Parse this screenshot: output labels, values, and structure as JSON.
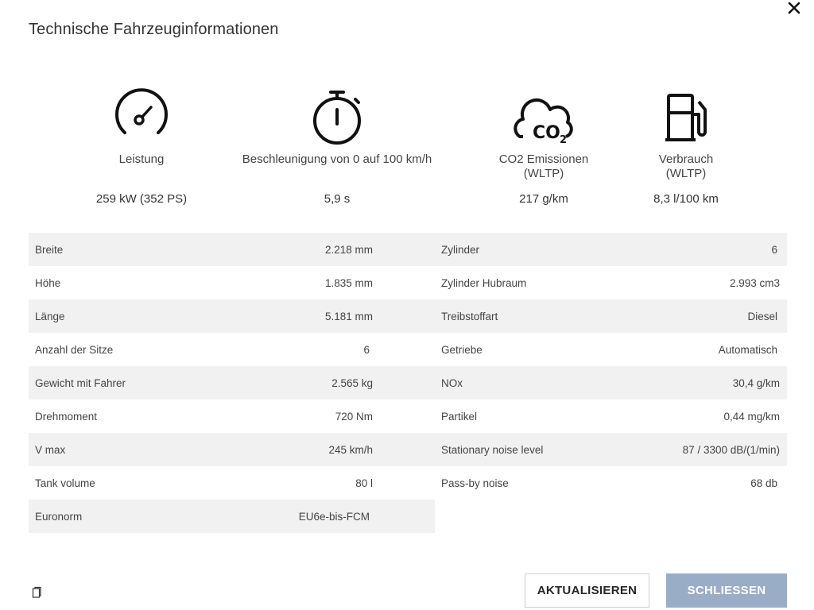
{
  "dialog": {
    "title": "Technische Fahrzeuginformationen"
  },
  "kpis": [
    {
      "icon": "speedometer-icon",
      "label": "Leistung",
      "value": "259 kW (352 PS)"
    },
    {
      "icon": "stopwatch-icon",
      "label": "Beschleunigung von 0 auf 100 km/h",
      "value": "5,9 s"
    },
    {
      "icon": "co2-cloud-icon",
      "label_line1": "CO2 Emissionen",
      "label_line2": "(WLTP)",
      "value": "217 g/km"
    },
    {
      "icon": "fuel-pump-icon",
      "label_line1": "Verbrauch",
      "label_line2": "(WLTP)",
      "value": "8,3 l/100 km"
    }
  ],
  "specs_left": [
    {
      "key": "Breite",
      "value": "2.218 mm"
    },
    {
      "key": "Höhe",
      "value": "1.835 mm"
    },
    {
      "key": "Länge",
      "value": "5.181 mm"
    },
    {
      "key": "Anzahl der Sitze",
      "value": "6"
    },
    {
      "key": "Gewicht mit Fahrer",
      "value": "2.565 kg"
    },
    {
      "key": "Drehmoment",
      "value": "720 Nm"
    },
    {
      "key": "V max",
      "value": "245 km/h"
    },
    {
      "key": "Tank volume",
      "value": "80 l"
    },
    {
      "key": "Euronorm",
      "value": "EU6e-bis-FCM"
    }
  ],
  "specs_right": [
    {
      "key": "Zylinder",
      "value": "6"
    },
    {
      "key": "Zylinder Hubraum",
      "value": "2.993 cm3"
    },
    {
      "key": "Treibstoffart",
      "value": "Diesel"
    },
    {
      "key": "Getriebe",
      "value": "Automatisch"
    },
    {
      "key": "NOx",
      "value": "30,4 g/km"
    },
    {
      "key": "Partikel",
      "value": "0,44 mg/km"
    },
    {
      "key": "Stationary noise level",
      "value": "87 / 3300 dB/(1/min)"
    },
    {
      "key": "Pass-by noise",
      "value": "68 db"
    }
  ],
  "buttons": {
    "refresh_label": "AKTUALISIEREN",
    "close_label": "SCHLIESSEN"
  },
  "colors": {
    "accent_button": "#9aadc6",
    "row_stripe": "#f1f1f1"
  }
}
